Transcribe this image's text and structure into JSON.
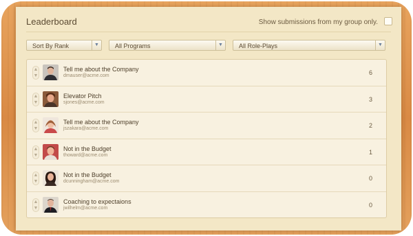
{
  "header": {
    "title": "Leaderboard",
    "group_filter_label": "Show submissions from my group only."
  },
  "filters": {
    "sort": "Sort By Rank",
    "programs": "All Programs",
    "roleplays": "All Role-Plays"
  },
  "rows": [
    {
      "title": "Tell me about the Company",
      "email": "dmauser@acme.com",
      "score": "6"
    },
    {
      "title": "Elevator Pitch",
      "email": "sjones@acme.com",
      "score": "3"
    },
    {
      "title": "Tell me about the Company",
      "email": "jszakara@acme.com",
      "score": "2"
    },
    {
      "title": "Not in the Budget",
      "email": "thoward@acme.com",
      "score": "1"
    },
    {
      "title": "Not in the Budget",
      "email": "dcunningham@acme.com",
      "score": "0"
    },
    {
      "title": "Coaching to expectaions",
      "email": "jwilhelm@acme.com",
      "score": "0"
    }
  ],
  "icons": {
    "dropdown": "chevron-down-icon",
    "vote_up": "vote-up-icon",
    "vote_down": "vote-down-icon"
  }
}
